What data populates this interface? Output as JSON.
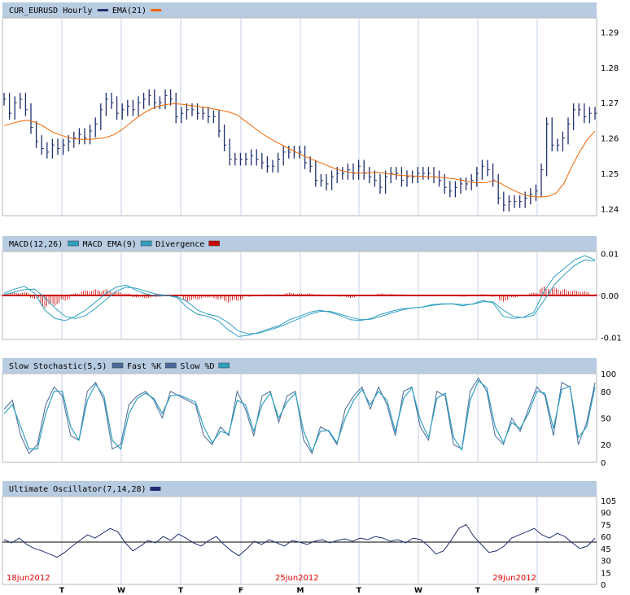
{
  "chart_data": [
    {
      "type": "ohlc",
      "title": "CUR_EURUSD Hourly",
      "legend": [
        {
          "name": "EMA(21)",
          "color": "#ee6600"
        }
      ],
      "series_color": "#1f2f6f",
      "ylim": [
        1.238,
        1.294
      ],
      "yticks": [
        "1.29",
        "1.28",
        "1.27",
        "1.26",
        "1.25",
        "1.24"
      ],
      "price_series": [
        1.271,
        1.267,
        1.27,
        1.271,
        1.268,
        1.263,
        1.259,
        1.257,
        1.256,
        1.258,
        1.257,
        1.258,
        1.259,
        1.26,
        1.261,
        1.26,
        1.262,
        1.264,
        1.268,
        1.271,
        1.27,
        1.267,
        1.268,
        1.269,
        1.268,
        1.27,
        1.271,
        1.272,
        1.27,
        1.27,
        1.272,
        1.271,
        1.266,
        1.267,
        1.268,
        1.268,
        1.267,
        1.267,
        1.266,
        1.266,
        1.262,
        1.258,
        1.254,
        1.254,
        1.254,
        1.254,
        1.255,
        1.254,
        1.253,
        1.252,
        1.252,
        1.254,
        1.256,
        1.256,
        1.256,
        1.256,
        1.253,
        1.252,
        1.248,
        1.248,
        1.247,
        1.249,
        1.25,
        1.25,
        1.251,
        1.25,
        1.252,
        1.25,
        1.249,
        1.248,
        1.246,
        1.249,
        1.25,
        1.25,
        1.248,
        1.249,
        1.249,
        1.25,
        1.25,
        1.25,
        1.249,
        1.248,
        1.246,
        1.245,
        1.246,
        1.247,
        1.247,
        1.248,
        1.25,
        1.252,
        1.251,
        1.248,
        1.243,
        1.241,
        1.242,
        1.242,
        1.242,
        1.243,
        1.244,
        1.245,
        1.251,
        1.264,
        1.258,
        1.258,
        1.26,
        1.264,
        1.268,
        1.268,
        1.266,
        1.267,
        1.267
      ],
      "ema_series": [
        1.2635,
        1.2641,
        1.2647,
        1.265,
        1.2645,
        1.2634,
        1.262,
        1.261,
        1.2603,
        1.2598,
        1.2596,
        1.2596,
        1.2598,
        1.2601,
        1.2608,
        1.2621,
        1.2638,
        1.2656,
        1.2671,
        1.2683,
        1.2691,
        1.2695,
        1.2697,
        1.2695,
        1.2692,
        1.2689,
        1.2686,
        1.2682,
        1.2678,
        1.2673,
        1.2665,
        1.2648,
        1.2632,
        1.2615,
        1.2601,
        1.2589,
        1.2577,
        1.2566,
        1.2555,
        1.2545,
        1.2536,
        1.2527,
        1.2518,
        1.251,
        1.2505,
        1.2501,
        1.2501,
        1.2502,
        1.2503,
        1.25,
        1.2497,
        1.2494,
        1.2493,
        1.2492,
        1.2491,
        1.249,
        1.2489,
        1.2487,
        1.2484,
        1.248,
        1.2475,
        1.2473,
        1.2474,
        1.2479,
        1.247,
        1.2458,
        1.2447,
        1.2438,
        1.2434,
        1.2433,
        1.2435,
        1.2444,
        1.2471,
        1.2518,
        1.256,
        1.2595,
        1.262
      ],
      "xlabels": [
        {
          "text": "18jun2012",
          "pos": 0.0
        },
        {
          "text": "25jun2012",
          "pos": 0.5
        },
        {
          "text": "29jun2012",
          "pos": 0.905
        }
      ]
    },
    {
      "type": "line",
      "title": "MACD(12,26)",
      "legend": [
        {
          "name": "MACD EMA(9)",
          "color": "#2f9fc0"
        },
        {
          "name": "Divergence",
          "color": "#cc0000"
        }
      ],
      "ylim": [
        -0.0105,
        0.0105
      ],
      "yticks": [
        "0.01",
        "0.00",
        "-0.01"
      ],
      "series": [
        {
          "name": "MACD(12,26)",
          "color": "#2f9fc0",
          "values": [
            0.0005,
            0.0015,
            0.0022,
            0.0005,
            -0.0035,
            -0.0055,
            -0.006,
            -0.005,
            -0.0035,
            -0.0015,
            0.0005,
            0.002,
            0.0025,
            0.0012,
            0.0003,
            -0.0001,
            0.0,
            -0.0005,
            -0.003,
            -0.0045,
            -0.005,
            -0.006,
            -0.0082,
            -0.0098,
            -0.0095,
            -0.0088,
            -0.008,
            -0.0072,
            -0.0058,
            -0.005,
            -0.004,
            -0.0035,
            -0.004,
            -0.0048,
            -0.0058,
            -0.006,
            -0.0055,
            -0.0045,
            -0.0038,
            -0.0032,
            -0.003,
            -0.0028,
            -0.0022,
            -0.002,
            -0.002,
            -0.0025,
            -0.002,
            -0.0012,
            -0.0018,
            -0.005,
            -0.0055,
            -0.0052,
            -0.004,
            0.001,
            0.0045,
            0.0065,
            0.0085,
            0.0095,
            0.0085
          ]
        },
        {
          "name": "MACD EMA(9)",
          "color": "#2f9fc0",
          "values": [
            0.0002,
            0.0008,
            0.0014,
            0.0015,
            -0.0005,
            -0.003,
            -0.005,
            -0.0055,
            -0.0048,
            -0.003,
            -0.001,
            0.001,
            0.002,
            0.0017,
            0.001,
            0.0003,
            0.0,
            -0.0003,
            -0.0015,
            -0.0035,
            -0.0045,
            -0.005,
            -0.0065,
            -0.0085,
            -0.0092,
            -0.009,
            -0.0083,
            -0.0075,
            -0.0065,
            -0.0055,
            -0.0045,
            -0.0038,
            -0.0038,
            -0.0045,
            -0.0052,
            -0.0058,
            -0.0057,
            -0.005,
            -0.0042,
            -0.0035,
            -0.003,
            -0.0028,
            -0.0024,
            -0.0021,
            -0.002,
            -0.0022,
            -0.0021,
            -0.0015,
            -0.0015,
            -0.0035,
            -0.005,
            -0.0053,
            -0.0047,
            -0.0012,
            0.0025,
            0.005,
            0.0072,
            0.0085,
            0.0082
          ]
        }
      ],
      "divergence": [
        0.0003,
        0.0007,
        0.0008,
        -0.0008,
        -0.003,
        -0.0025,
        -0.0012,
        0.0005,
        0.0013,
        0.0015,
        0.0015,
        0.001,
        0.0005,
        -0.0005,
        -0.0007,
        -0.0004,
        0.0,
        -0.0002,
        -0.0015,
        -0.001,
        -0.0005,
        -0.001,
        -0.0017,
        -0.0013,
        -0.0003,
        0.0002,
        0.0003,
        0.0003,
        0.0007,
        0.0005,
        0.0005,
        0.0003,
        -0.0002,
        -0.0003,
        -0.0006,
        -0.0002,
        0.0002,
        0.0005,
        0.0004,
        0.0003,
        0.0,
        0.0,
        0.0002,
        0.0001,
        0.0,
        -0.0003,
        0.0001,
        0.0003,
        -0.0003,
        -0.0015,
        -0.0005,
        0.0001,
        0.0007,
        0.0022,
        0.002,
        0.0015,
        0.0013,
        0.001,
        0.0003
      ]
    },
    {
      "type": "line",
      "title": "Slow Stochastic(5,5)",
      "legend": [
        {
          "name": "Fast %K",
          "color": "#4a6a9a"
        },
        {
          "name": "Slow %D",
          "color": "#2fa0c0"
        }
      ],
      "ylim": [
        0,
        100
      ],
      "yticks": [
        "100",
        "80",
        "50",
        "20",
        "0"
      ],
      "series": [
        {
          "name": "Fast %K",
          "color": "#4a6a9a",
          "values": [
            60,
            70,
            30,
            10,
            20,
            65,
            85,
            75,
            30,
            25,
            80,
            90,
            70,
            15,
            20,
            65,
            75,
            80,
            70,
            50,
            80,
            75,
            70,
            65,
            30,
            20,
            40,
            30,
            80,
            60,
            30,
            75,
            80,
            45,
            75,
            80,
            25,
            10,
            40,
            35,
            20,
            60,
            75,
            85,
            60,
            85,
            65,
            30,
            80,
            85,
            40,
            25,
            80,
            75,
            20,
            15,
            80,
            95,
            80,
            30,
            20,
            50,
            35,
            60,
            85,
            75,
            30,
            90,
            85,
            20,
            45,
            90
          ]
        },
        {
          "name": "Slow %D",
          "color": "#2fa0c0",
          "values": [
            55,
            65,
            40,
            15,
            15,
            55,
            80,
            80,
            40,
            25,
            70,
            88,
            75,
            25,
            15,
            55,
            72,
            78,
            72,
            55,
            75,
            76,
            72,
            68,
            40,
            22,
            35,
            32,
            70,
            65,
            35,
            65,
            78,
            50,
            68,
            78,
            35,
            12,
            35,
            36,
            22,
            50,
            70,
            82,
            65,
            80,
            70,
            35,
            72,
            84,
            48,
            28,
            72,
            78,
            28,
            14,
            70,
            92,
            84,
            40,
            22,
            45,
            38,
            55,
            80,
            78,
            38,
            82,
            86,
            28,
            40,
            85
          ]
        }
      ]
    },
    {
      "type": "line",
      "title": "Ultimate Oscillator(7,14,28)",
      "legend": [
        {
          "name": "Ultimate Oscillator(7,14,28)",
          "color": "#1f2f6f"
        }
      ],
      "ylim": [
        0,
        110
      ],
      "yticks": [
        "105",
        "90",
        "75",
        "60",
        "45",
        "30",
        "15",
        "0"
      ],
      "refline": 53,
      "series": [
        {
          "name": "Ultimate Oscillator(7,14,28)",
          "color": "#1f2f6f",
          "values": [
            56,
            52,
            58,
            50,
            45,
            42,
            38,
            34,
            40,
            48,
            55,
            62,
            58,
            64,
            70,
            66,
            52,
            42,
            48,
            55,
            52,
            60,
            55,
            63,
            58,
            52,
            48,
            55,
            60,
            50,
            42,
            36,
            44,
            54,
            50,
            56,
            52,
            48,
            55,
            53,
            50,
            54,
            56,
            52,
            55,
            57,
            54,
            58,
            56,
            60,
            58,
            54,
            56,
            52,
            58,
            56,
            48,
            38,
            42,
            55,
            70,
            75,
            60,
            50,
            40,
            42,
            48,
            58,
            62,
            66,
            70,
            62,
            58,
            64,
            60,
            52,
            45,
            48,
            58
          ]
        }
      ]
    }
  ],
  "day_labels": [
    "T",
    "W",
    "T",
    "F",
    "M",
    "T",
    "W",
    "T",
    "F"
  ]
}
